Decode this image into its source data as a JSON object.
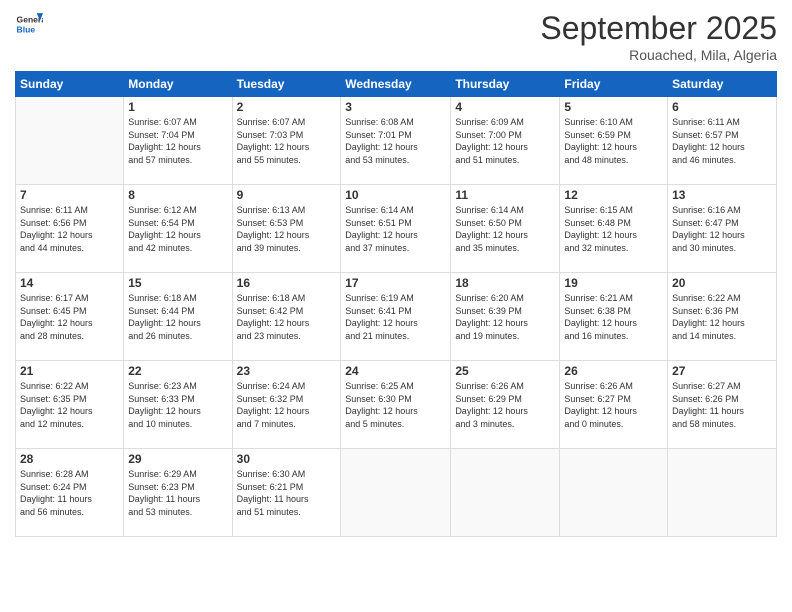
{
  "header": {
    "logo_general": "General",
    "logo_blue": "Blue",
    "month_title": "September 2025",
    "location": "Rouached, Mila, Algeria"
  },
  "weekdays": [
    "Sunday",
    "Monday",
    "Tuesday",
    "Wednesday",
    "Thursday",
    "Friday",
    "Saturday"
  ],
  "weeks": [
    [
      {
        "day": "",
        "info": ""
      },
      {
        "day": "1",
        "info": "Sunrise: 6:07 AM\nSunset: 7:04 PM\nDaylight: 12 hours\nand 57 minutes."
      },
      {
        "day": "2",
        "info": "Sunrise: 6:07 AM\nSunset: 7:03 PM\nDaylight: 12 hours\nand 55 minutes."
      },
      {
        "day": "3",
        "info": "Sunrise: 6:08 AM\nSunset: 7:01 PM\nDaylight: 12 hours\nand 53 minutes."
      },
      {
        "day": "4",
        "info": "Sunrise: 6:09 AM\nSunset: 7:00 PM\nDaylight: 12 hours\nand 51 minutes."
      },
      {
        "day": "5",
        "info": "Sunrise: 6:10 AM\nSunset: 6:59 PM\nDaylight: 12 hours\nand 48 minutes."
      },
      {
        "day": "6",
        "info": "Sunrise: 6:11 AM\nSunset: 6:57 PM\nDaylight: 12 hours\nand 46 minutes."
      }
    ],
    [
      {
        "day": "7",
        "info": "Sunrise: 6:11 AM\nSunset: 6:56 PM\nDaylight: 12 hours\nand 44 minutes."
      },
      {
        "day": "8",
        "info": "Sunrise: 6:12 AM\nSunset: 6:54 PM\nDaylight: 12 hours\nand 42 minutes."
      },
      {
        "day": "9",
        "info": "Sunrise: 6:13 AM\nSunset: 6:53 PM\nDaylight: 12 hours\nand 39 minutes."
      },
      {
        "day": "10",
        "info": "Sunrise: 6:14 AM\nSunset: 6:51 PM\nDaylight: 12 hours\nand 37 minutes."
      },
      {
        "day": "11",
        "info": "Sunrise: 6:14 AM\nSunset: 6:50 PM\nDaylight: 12 hours\nand 35 minutes."
      },
      {
        "day": "12",
        "info": "Sunrise: 6:15 AM\nSunset: 6:48 PM\nDaylight: 12 hours\nand 32 minutes."
      },
      {
        "day": "13",
        "info": "Sunrise: 6:16 AM\nSunset: 6:47 PM\nDaylight: 12 hours\nand 30 minutes."
      }
    ],
    [
      {
        "day": "14",
        "info": "Sunrise: 6:17 AM\nSunset: 6:45 PM\nDaylight: 12 hours\nand 28 minutes."
      },
      {
        "day": "15",
        "info": "Sunrise: 6:18 AM\nSunset: 6:44 PM\nDaylight: 12 hours\nand 26 minutes."
      },
      {
        "day": "16",
        "info": "Sunrise: 6:18 AM\nSunset: 6:42 PM\nDaylight: 12 hours\nand 23 minutes."
      },
      {
        "day": "17",
        "info": "Sunrise: 6:19 AM\nSunset: 6:41 PM\nDaylight: 12 hours\nand 21 minutes."
      },
      {
        "day": "18",
        "info": "Sunrise: 6:20 AM\nSunset: 6:39 PM\nDaylight: 12 hours\nand 19 minutes."
      },
      {
        "day": "19",
        "info": "Sunrise: 6:21 AM\nSunset: 6:38 PM\nDaylight: 12 hours\nand 16 minutes."
      },
      {
        "day": "20",
        "info": "Sunrise: 6:22 AM\nSunset: 6:36 PM\nDaylight: 12 hours\nand 14 minutes."
      }
    ],
    [
      {
        "day": "21",
        "info": "Sunrise: 6:22 AM\nSunset: 6:35 PM\nDaylight: 12 hours\nand 12 minutes."
      },
      {
        "day": "22",
        "info": "Sunrise: 6:23 AM\nSunset: 6:33 PM\nDaylight: 12 hours\nand 10 minutes."
      },
      {
        "day": "23",
        "info": "Sunrise: 6:24 AM\nSunset: 6:32 PM\nDaylight: 12 hours\nand 7 minutes."
      },
      {
        "day": "24",
        "info": "Sunrise: 6:25 AM\nSunset: 6:30 PM\nDaylight: 12 hours\nand 5 minutes."
      },
      {
        "day": "25",
        "info": "Sunrise: 6:26 AM\nSunset: 6:29 PM\nDaylight: 12 hours\nand 3 minutes."
      },
      {
        "day": "26",
        "info": "Sunrise: 6:26 AM\nSunset: 6:27 PM\nDaylight: 12 hours\nand 0 minutes."
      },
      {
        "day": "27",
        "info": "Sunrise: 6:27 AM\nSunset: 6:26 PM\nDaylight: 11 hours\nand 58 minutes."
      }
    ],
    [
      {
        "day": "28",
        "info": "Sunrise: 6:28 AM\nSunset: 6:24 PM\nDaylight: 11 hours\nand 56 minutes."
      },
      {
        "day": "29",
        "info": "Sunrise: 6:29 AM\nSunset: 6:23 PM\nDaylight: 11 hours\nand 53 minutes."
      },
      {
        "day": "30",
        "info": "Sunrise: 6:30 AM\nSunset: 6:21 PM\nDaylight: 11 hours\nand 51 minutes."
      },
      {
        "day": "",
        "info": ""
      },
      {
        "day": "",
        "info": ""
      },
      {
        "day": "",
        "info": ""
      },
      {
        "day": "",
        "info": ""
      }
    ]
  ]
}
